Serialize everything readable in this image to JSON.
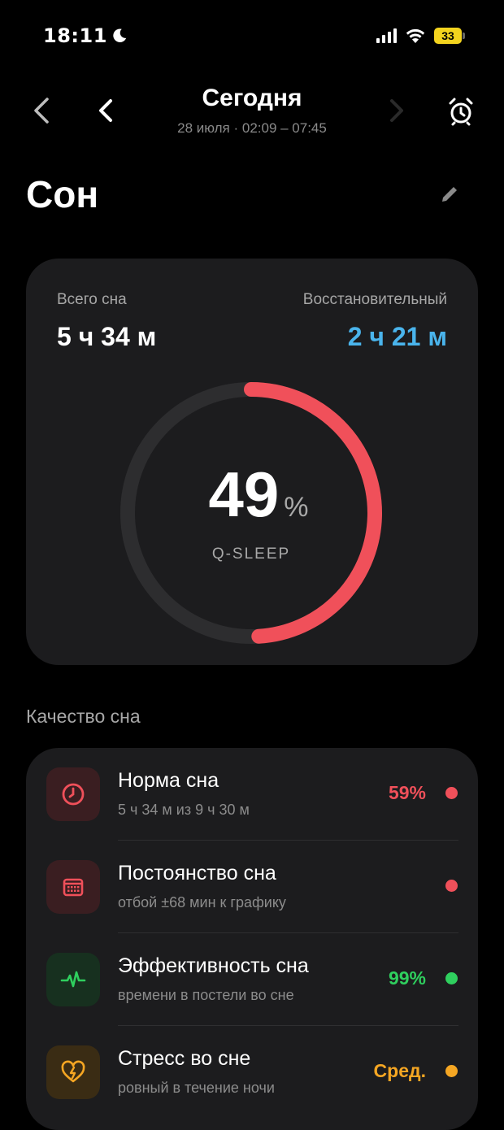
{
  "status_bar": {
    "time": "18:11",
    "battery": "33"
  },
  "header": {
    "title": "Сегодня",
    "subtitle": "28 июля · 02:09 – 07:45"
  },
  "page": {
    "title": "Сон"
  },
  "summary": {
    "total_label": "Всего сна",
    "total_value": "5 ч 34 м",
    "restorative_label": "Восстановительный",
    "restorative_value": "2 ч 21 м",
    "score": "49",
    "score_unit": "%",
    "score_fraction": 0.49,
    "score_label": "Q-SLEEP",
    "accent_color": "#f0505a",
    "restorative_color": "#4ab4ec"
  },
  "quality": {
    "section_title": "Качество сна",
    "items": [
      {
        "icon": "clock-icon",
        "title": "Норма сна",
        "subtitle": "5 ч 34 м из 9 ч 30 м",
        "value": "59%",
        "color": "#f0505a"
      },
      {
        "icon": "calendar-icon",
        "title": "Постоянство сна",
        "subtitle": "отбой ±68 мин к графику",
        "value": "",
        "color": "#f0505a"
      },
      {
        "icon": "heartbeat-icon",
        "title": "Эффективность сна",
        "subtitle": "времени в постели во сне",
        "value": "99%",
        "color": "#2fcf5e"
      },
      {
        "icon": "heart-bolt-icon",
        "title": "Стресс во сне",
        "subtitle": "ровный в течение ночи",
        "value": "Сред.",
        "color": "#f5a623"
      }
    ]
  }
}
